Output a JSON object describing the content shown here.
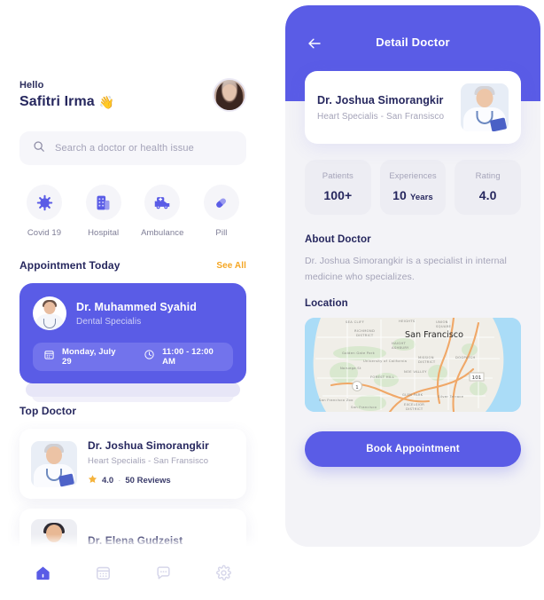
{
  "colors": {
    "primary": "#5a5ce6",
    "primary_light": "#7273ec",
    "text_dark": "#26275e",
    "text_muted": "#a4a3b8",
    "accent_orange": "#f5a623",
    "star_yellow": "#f5b33c",
    "panel_bg": "#f3f3f7",
    "field_bg": "#f6f6fa"
  },
  "home": {
    "greeting": "Hello",
    "user_name": "Safitri Irma",
    "wave_emoji": "👋",
    "avatar_name": "user-avatar",
    "search": {
      "placeholder": "Search a doctor or health issue",
      "icon": "search-icon"
    },
    "categories": [
      {
        "label": "Covid 19",
        "icon": "virus-icon"
      },
      {
        "label": "Hospital",
        "icon": "hospital-building-icon"
      },
      {
        "label": "Ambulance",
        "icon": "ambulance-icon"
      },
      {
        "label": "Pill",
        "icon": "pill-capsule-icon"
      }
    ],
    "appointment_section": {
      "title": "Appointment Today",
      "see_all": "See All"
    },
    "appointment": {
      "doctor_name": "Dr. Muhammed Syahid",
      "specialty": "Dental Specialis",
      "date": "Monday, July 29",
      "time": "11:00 - 12:00 AM",
      "calendar_icon": "calendar-icon",
      "clock_icon": "clock-icon"
    },
    "top_doctor_section": {
      "title": "Top Doctor"
    },
    "top_doctors": [
      {
        "name": "Dr. Joshua Simorangkir",
        "specialty": "Heart Specialis - San Fransisco",
        "rating": "4.0",
        "separator": "·",
        "reviews": "50 Reviews",
        "star_icon": "star-icon"
      },
      {
        "name": "Dr. Elena Gudzeist",
        "specialty": "",
        "rating": "",
        "separator": "",
        "reviews": "",
        "star_icon": "star-icon"
      }
    ],
    "bottom_nav": [
      {
        "icon": "home-icon",
        "label": "Home",
        "active": true
      },
      {
        "icon": "calendar-icon",
        "label": "Schedule",
        "active": false
      },
      {
        "icon": "chat-bubble-icon",
        "label": "Messages",
        "active": false
      },
      {
        "icon": "gear-icon",
        "label": "Settings",
        "active": false
      }
    ]
  },
  "detail": {
    "title": "Detail Doctor",
    "back_icon": "back-arrow-icon",
    "doctor": {
      "name": "Dr. Joshua Simorangkir",
      "specialty": "Heart Specialis - San Fransisco"
    },
    "stats": [
      {
        "label": "Patients",
        "value": "100+",
        "unit": ""
      },
      {
        "label": "Experiences",
        "value": "10",
        "unit": "Years"
      },
      {
        "label": "Rating",
        "value": "4.0",
        "unit": ""
      }
    ],
    "about": {
      "title": "About Doctor",
      "text": "Dr. Joshua Simorangkir is a specialist in internal medicine who specializes."
    },
    "location": {
      "title": "Location",
      "map_city": "San Francisco",
      "map_labels": [
        "HEIGHTS",
        "UNION SQUARE",
        "RICHMOND DISTRICT",
        "HAIGHT ASHBURY",
        "Golden Gate Park",
        "University of California",
        "MISSION DISTRICT",
        "DOGPATCH",
        "Noruega St",
        "NOE VALLEY",
        "FOREST HILL",
        "GLEN PARK",
        "Silver Terrace",
        "EXCELSIOR DISTRICT",
        "San Francisco Zoo",
        "San Francisco State University",
        "101",
        "1"
      ]
    },
    "book_button": "Book Appointment"
  }
}
